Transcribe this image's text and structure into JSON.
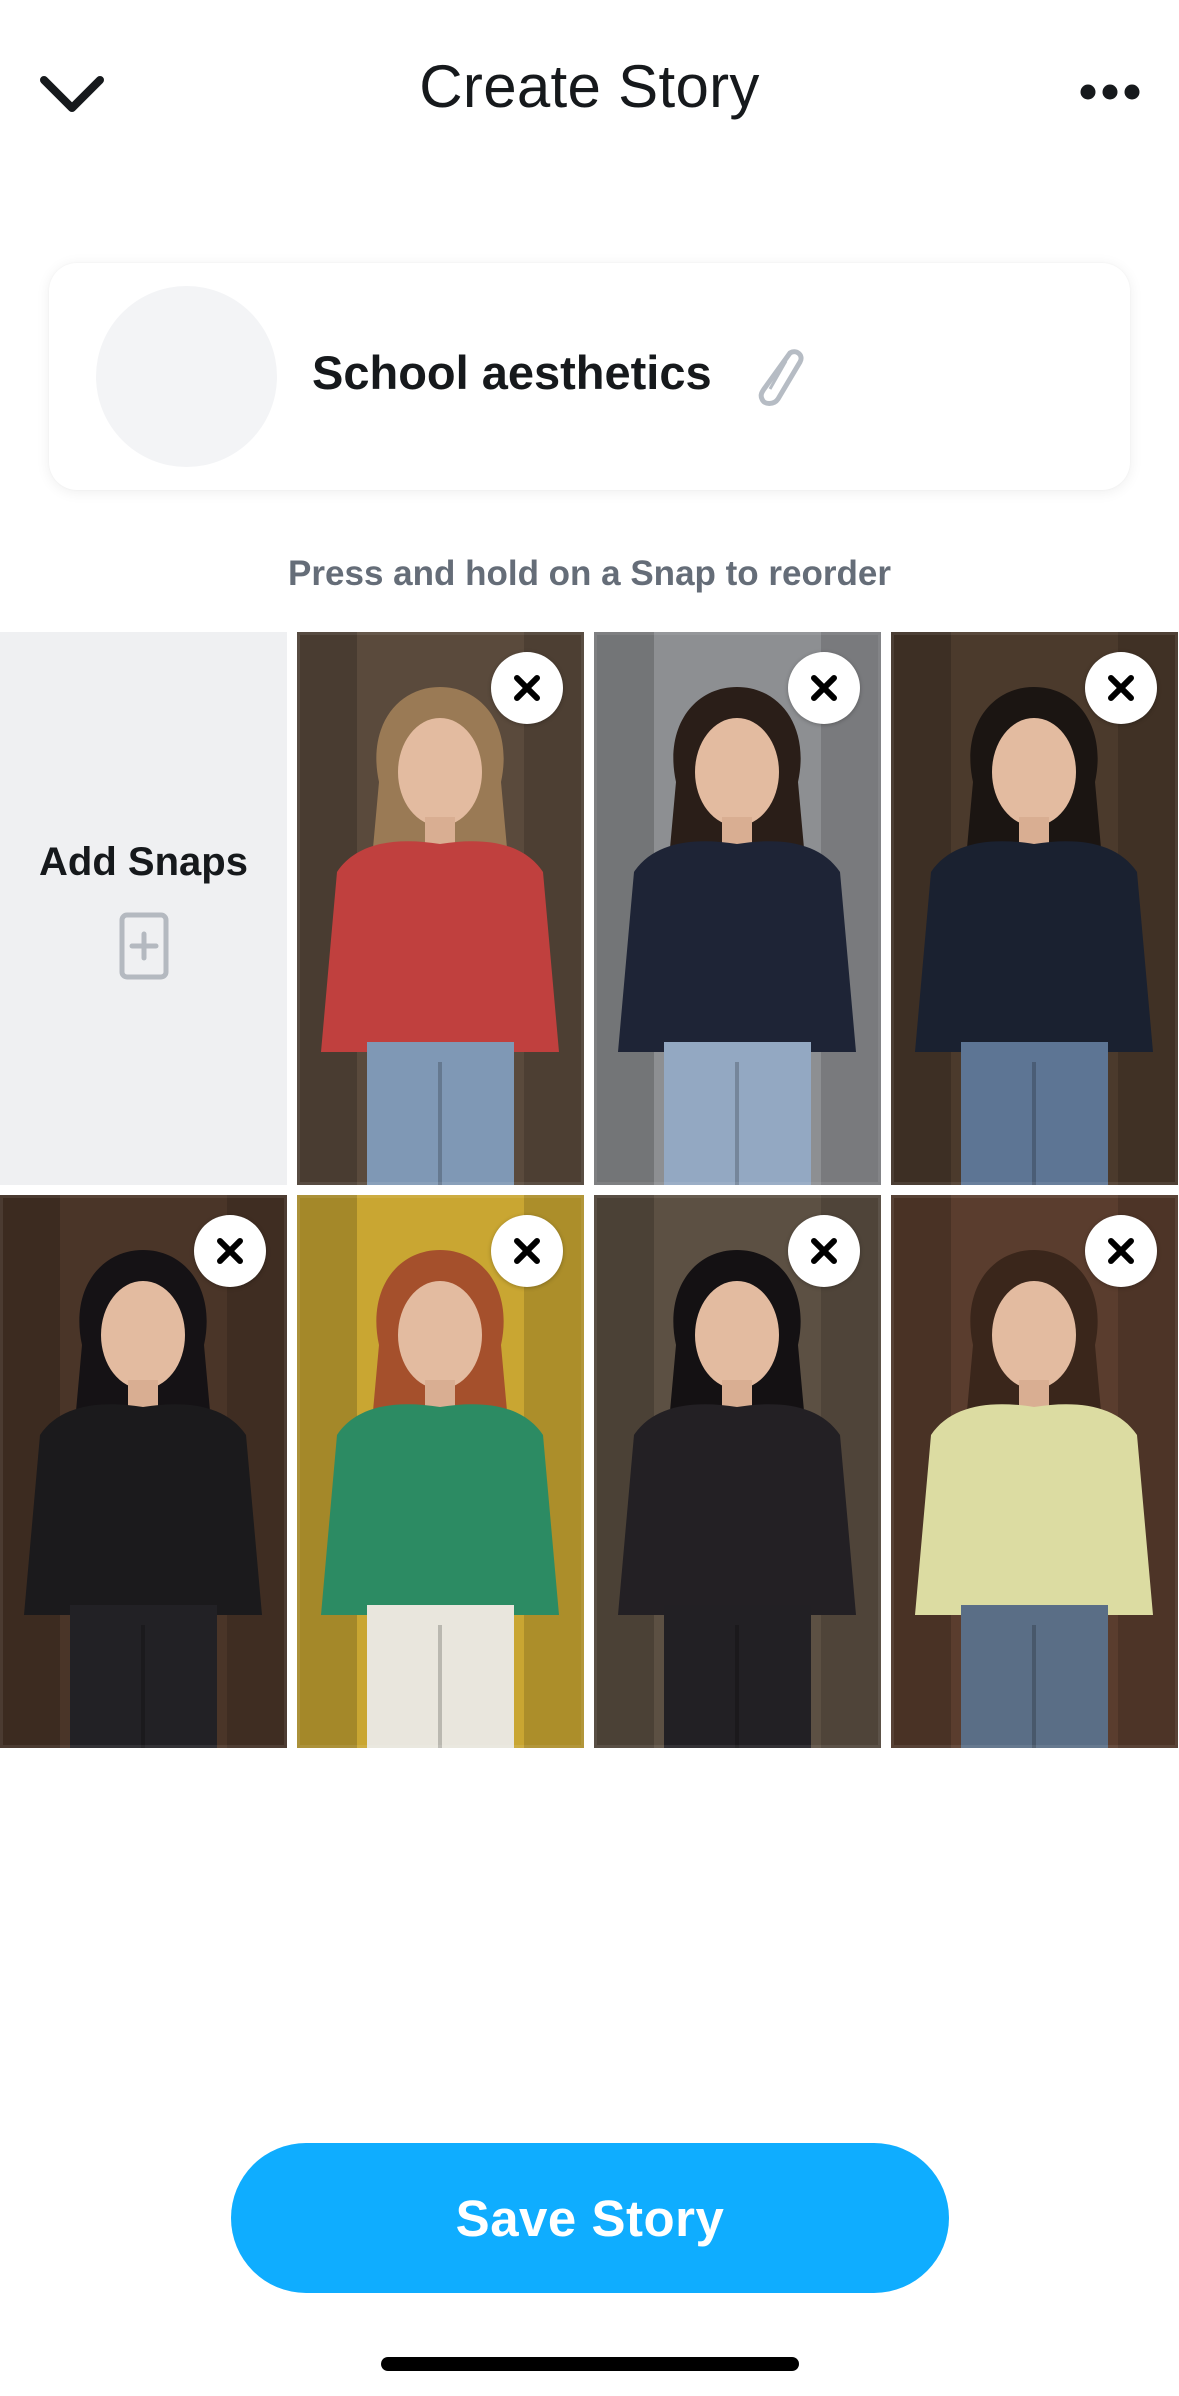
{
  "header": {
    "title": "Create Story",
    "back_icon": "chevron-down-icon",
    "more_icon": "more-horizontal-icon"
  },
  "story": {
    "name": "School aesthetics",
    "edit_icon": "pencil-icon"
  },
  "hint": "Press and hold on a Snap to reorder",
  "add_snaps": {
    "label": "Add Snaps",
    "icon": "add-snap-icon"
  },
  "snaps": [
    {
      "description": "plaid-shirt-library",
      "bg": "#5a4a3c",
      "top": "#c0403e",
      "hair": "#9a7a55",
      "pants": "#7f98b5"
    },
    {
      "description": "varsity-jacket",
      "bg": "#8d8f92",
      "top": "#1e2436",
      "hair": "#2a1e18",
      "pants": "#93a8c2"
    },
    {
      "description": "leather-jacket-bookshelf",
      "bg": "#4b3a2c",
      "top": "#1a2130",
      "hair": "#1b1512",
      "pants": "#5d7594"
    },
    {
      "description": "black-outfit-library",
      "bg": "#4a3528",
      "top": "#1b1a1c",
      "hair": "#151215",
      "pants": "#222125"
    },
    {
      "description": "green-cardigan-lockers",
      "bg": "#c9a632",
      "top": "#2c8b63",
      "hair": "#a5502c",
      "pants": "#e9e6dd"
    },
    {
      "description": "black-blouse-hallway",
      "bg": "#5c5043",
      "top": "#232024",
      "hair": "#141113",
      "pants": "#222024"
    },
    {
      "description": "yellow-sweater-bookshelf",
      "bg": "#5a3d2e",
      "top": "#dcdca2",
      "hair": "#3a261b",
      "pants": "#5a6e86"
    }
  ],
  "save_button": "Save Story",
  "colors": {
    "accent": "#0fadff",
    "hint_text": "#656d78",
    "add_tile_bg": "#eff0f2"
  }
}
